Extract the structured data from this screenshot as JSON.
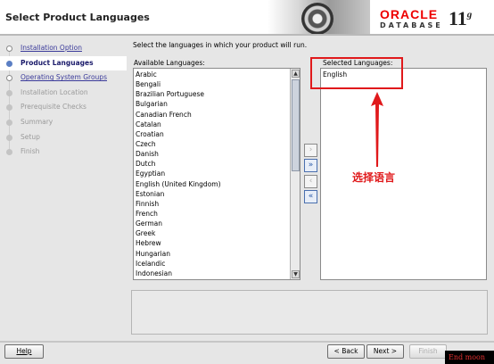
{
  "window": {
    "title": "Select Product Languages"
  },
  "brand": {
    "logo": "ORACLE",
    "product": "DATABASE",
    "version": "11",
    "version_sup": "g"
  },
  "nav": {
    "items": [
      {
        "label": "Installation Option",
        "state": "done"
      },
      {
        "label": "Product Languages",
        "state": "active"
      },
      {
        "label": "Operating System Groups",
        "state": "done"
      },
      {
        "label": "Installation Location",
        "state": "pending"
      },
      {
        "label": "Prerequisite Checks",
        "state": "pending"
      },
      {
        "label": "Summary",
        "state": "pending"
      },
      {
        "label": "Setup",
        "state": "pending"
      },
      {
        "label": "Finish",
        "state": "pending"
      }
    ]
  },
  "main": {
    "instruction": "Select the languages in which your product will run.",
    "available_label": "Available Languages:",
    "selected_label": "Selected Languages:",
    "available": [
      "Arabic",
      "Bengali",
      "Brazilian Portuguese",
      "Bulgarian",
      "Canadian French",
      "Catalan",
      "Croatian",
      "Czech",
      "Danish",
      "Dutch",
      "Egyptian",
      "English (United Kingdom)",
      "Estonian",
      "Finnish",
      "French",
      "German",
      "Greek",
      "Hebrew",
      "Hungarian",
      "Icelandic",
      "Indonesian"
    ],
    "selected": [
      "English"
    ],
    "move_buttons": [
      "›",
      "»",
      "‹",
      "«"
    ]
  },
  "annotation": {
    "text": "选择语言",
    "color": "#e0191b"
  },
  "buttons": {
    "help": "Help",
    "back": "< Back",
    "next": "Next >",
    "finish": "Finish"
  },
  "watermark": "End moon"
}
